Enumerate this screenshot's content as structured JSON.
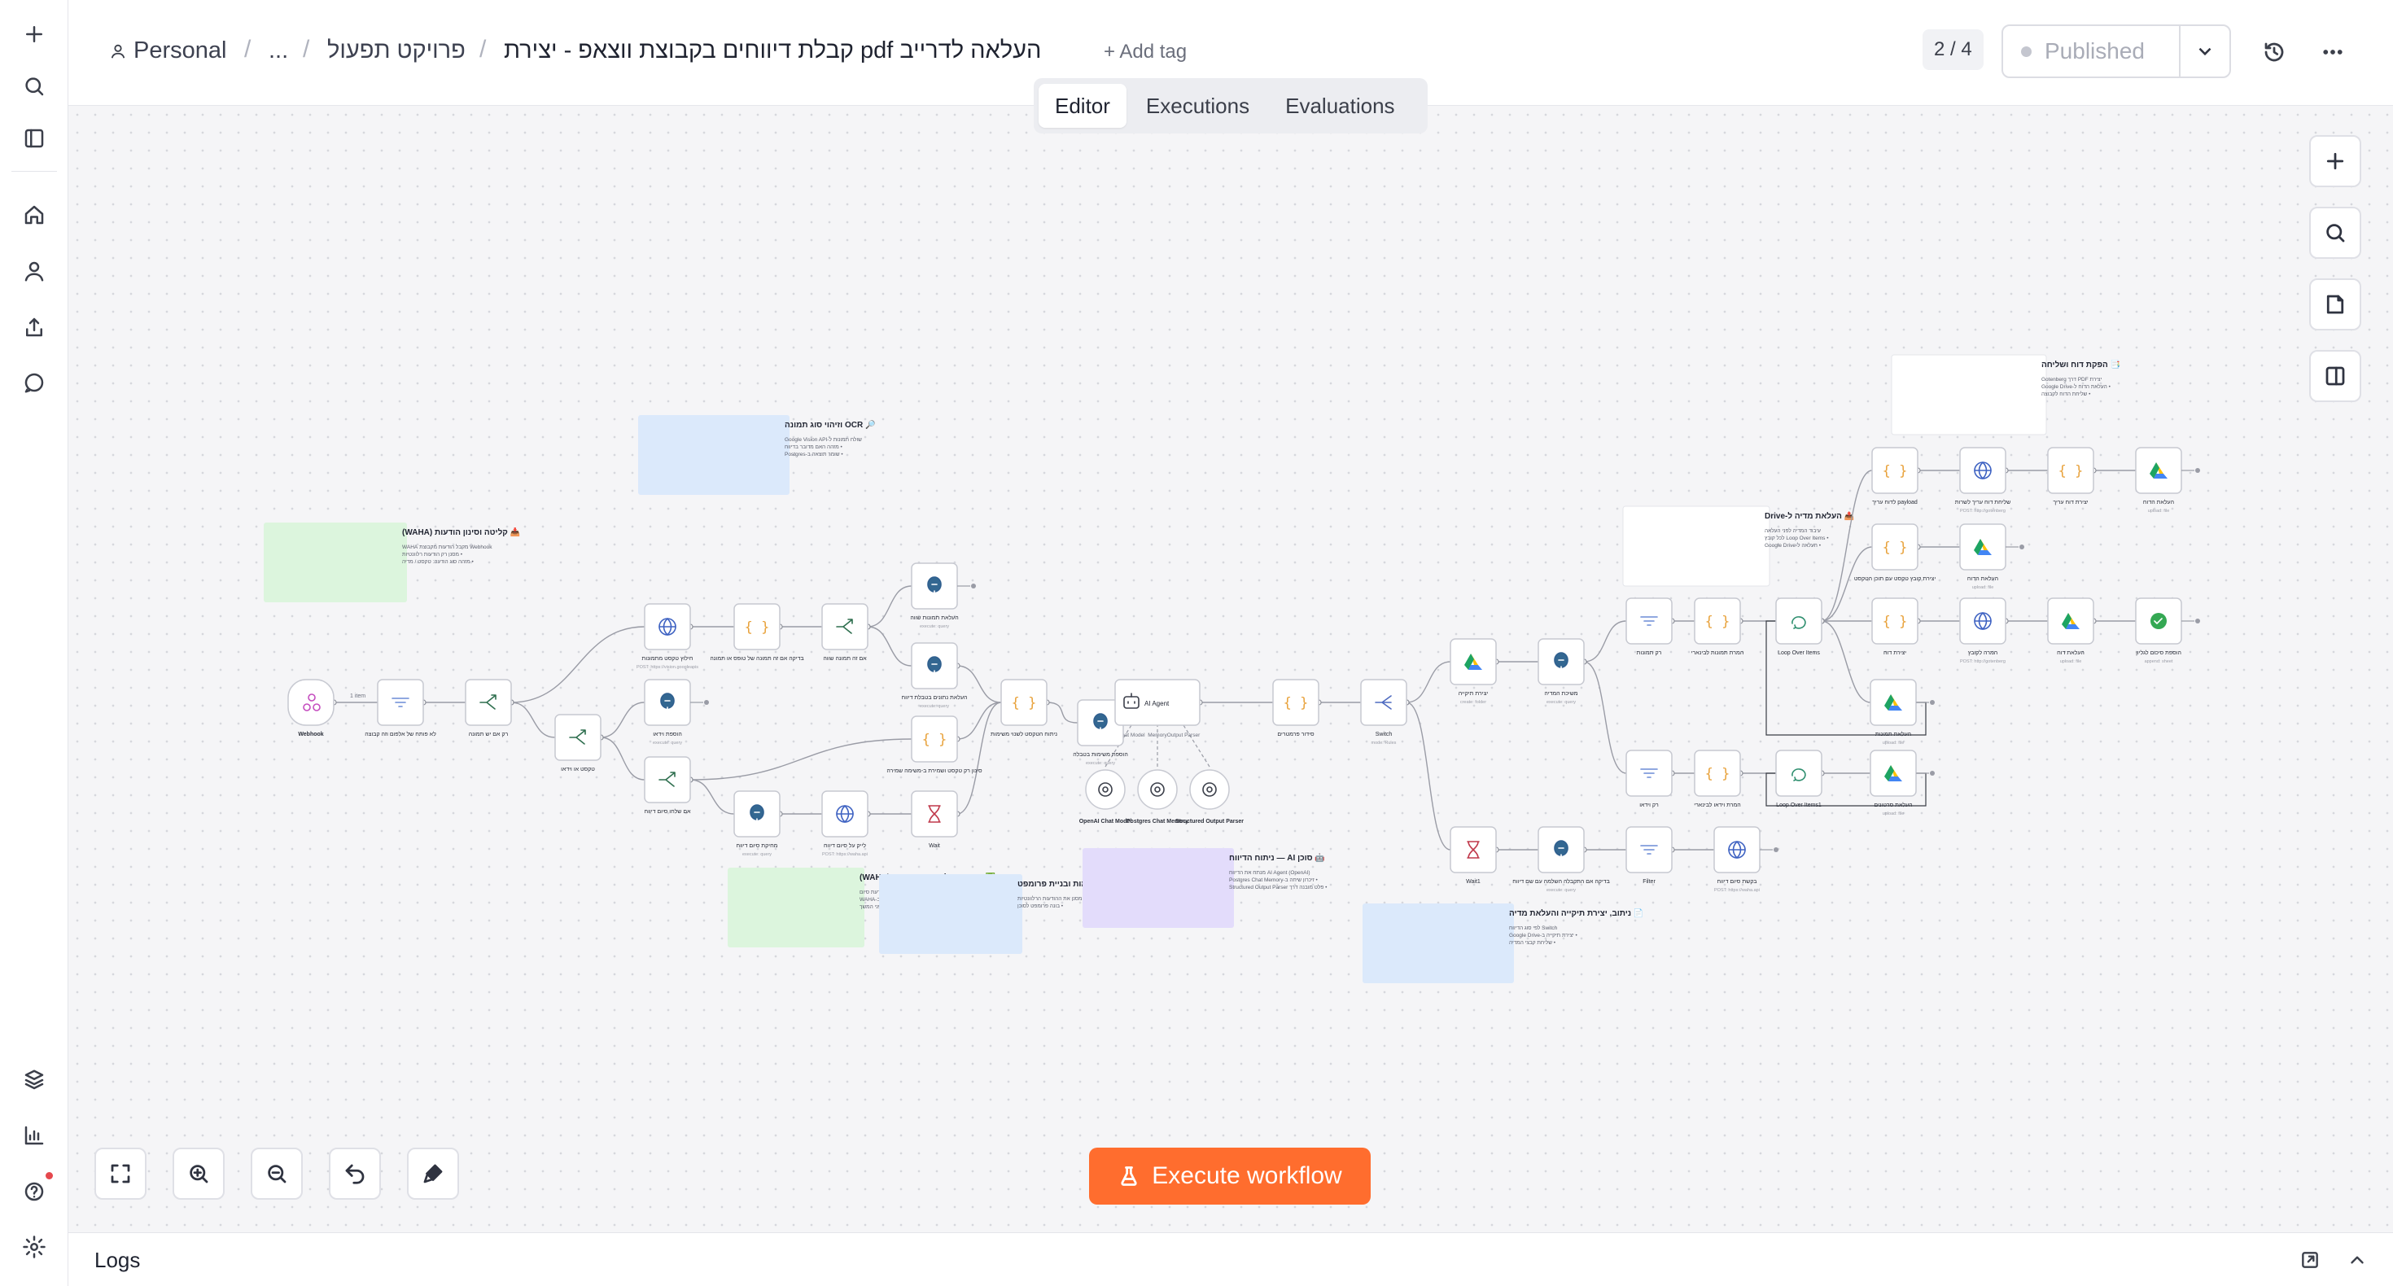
{
  "header": {
    "owner": "Personal",
    "ellipsis": "...",
    "project": "פרויקט תפעול",
    "workflow_title": "העלאה לדרייב pdf קבלת דיווחים בקבוצת ווצאפ - יצירת",
    "add_tag": "+ Add tag",
    "counter": "2 / 4",
    "publish_label": "Published"
  },
  "tabs": [
    {
      "label": "Editor",
      "active": true
    },
    {
      "label": "Executions",
      "active": false
    },
    {
      "label": "Evaluations",
      "active": false
    }
  ],
  "execute_label": "Execute workflow",
  "logs_label": "Logs",
  "colors": {
    "accent": "#ff6d2e",
    "canvas_bg": "#f5f5f7",
    "note_green": "#dcf5dd",
    "note_blue": "#dbe9fb",
    "note_purple": "#e3dcfb",
    "note_neutral": "#ffffff",
    "edge": "#9a9ca6",
    "edge_loop": "#3a3d46"
  },
  "workflow": {
    "notes": [
      {
        "id": "n1",
        "color": "green",
        "title": "📥 קליטה וסינון הודעות (WAHA)",
        "lines": [
          "Webhook מקבל הודעות מקבוצת WAHA",
          "• מסנן רק הודעות רלוונטיות",
          "• מזהה סוג הודעה: טקסט / מדיה"
        ]
      },
      {
        "id": "n2",
        "color": "blue",
        "title": "🔎 OCR וזיהוי סוג תמונה",
        "lines": [
          "שולח תמונות ל-Google Vision API",
          "• מזהה האם מדובר בדיווח",
          "• שומר תוצאה ב-Postgres"
        ]
      },
      {
        "id": "n3",
        "color": "green",
        "title": "✅ אישור קבלת \"סיום דיווח\" (WAHA)",
        "lines": [
          "בודק אם התקבלה הודעת סיום",
          "• שולח אישור ב-WAHA",
          "• Wait — ממתין לפני המשך"
        ]
      },
      {
        "id": "n4",
        "color": "blue",
        "title": "⚙ סינון משימות ובניית פרומפט",
        "lines": [
          "מסנן את ההודעות הרלוונטיות",
          "• בונה פרומפט לסוכן"
        ]
      },
      {
        "id": "n5",
        "color": "purple",
        "title": "🤖 סוכן AI — ניתוח הדיווח",
        "lines": [
          "AI Agent (OpenAI) מנתח את הדיווח",
          "• זיכרון שיחה ב-Postgres Chat Memory",
          "• פלט מובנה דרך Structured Output Parser"
        ]
      },
      {
        "id": "n6",
        "color": "blue",
        "title": "📄 ניתוב, יצירת תיקייה והעלאת מדיה",
        "lines": [
          "Switch לפי סוג הדיווח",
          "• יצירת תיקייה ב-Google Drive",
          "• שליחת קבצי המדיה"
        ]
      },
      {
        "id": "n7",
        "color": "neutral",
        "title": "📤 העלאת מדיה ל-Drive",
        "lines": [
          "עיבוד המדיה לפני העלאה",
          "• Loop Over Items לכל קובץ",
          "• העלאה ל-Google Drive"
        ]
      },
      {
        "id": "n8",
        "color": "neutral",
        "title": "📑 הפקת דוח ושליחה",
        "lines": [
          "יצירת PDF דרך Gotenberg",
          "• העלאת הדוח ל-Google Drive",
          "• שליחת הדוח לקבוצה"
        ]
      }
    ],
    "nodes": [
      {
        "id": "webhook",
        "label": "Webhook",
        "sub": "",
        "icon": "webhook-icon",
        "kind": "trigger"
      },
      {
        "id": "filter1",
        "label": "לא פותח של אלפום וזה קבוצה",
        "sub": "",
        "icon": "filter-icon",
        "kind": "filter"
      },
      {
        "id": "if1",
        "label": "רק אם יש תמונה",
        "sub": "",
        "icon": "branch-icon",
        "kind": "if"
      },
      {
        "id": "if2",
        "label": "טקסט או וידאו",
        "sub": "",
        "icon": "branch-icon",
        "kind": "if"
      },
      {
        "id": "http1",
        "label": "חילוץ טקסט מתמונות",
        "sub": "POST: https://vision.googleapis",
        "icon": "globe-icon",
        "kind": "http"
      },
      {
        "id": "code1",
        "label": "בדיקה אם זה תמונה של טופס או תמונה",
        "sub": "",
        "icon": "code-icon",
        "kind": "code"
      },
      {
        "id": "if3",
        "label": "אם זה תמונה שווה",
        "sub": "",
        "icon": "branch-icon",
        "kind": "if"
      },
      {
        "id": "pg1",
        "label": "העלאת תמונות שווה",
        "sub": "execute: query",
        "icon": "postgres-icon",
        "kind": "pg"
      },
      {
        "id": "pg2",
        "label": "העלאת נתונים בטבלת דיווח",
        "sub": "execute: query",
        "icon": "postgres-icon",
        "kind": "pg"
      },
      {
        "id": "pg3",
        "label": "הוספת וידאו",
        "sub": "execute: query",
        "icon": "postgres-icon",
        "kind": "pg"
      },
      {
        "id": "if4",
        "label": "אם שלחו סיום דיווח",
        "sub": "",
        "icon": "branch-icon",
        "kind": "if"
      },
      {
        "id": "code2",
        "label": "סינון רק טקסט ושמירת ב-משימה שמירה",
        "sub": "",
        "icon": "code-icon",
        "kind": "code"
      },
      {
        "id": "pg4",
        "label": "מחיקת סיום דיווח",
        "sub": "execute: query",
        "icon": "postgres-icon",
        "kind": "pg"
      },
      {
        "id": "http2",
        "label": "לייק על סיום דיווח",
        "sub": "POST: https://waha.api",
        "icon": "globe-icon",
        "kind": "http"
      },
      {
        "id": "wait1",
        "label": "Wait",
        "sub": "",
        "icon": "hourglass-icon",
        "kind": "wait"
      },
      {
        "id": "code3",
        "label": "ניתוח הטקסט לשנוי משימות",
        "sub": "",
        "icon": "code-icon",
        "kind": "code"
      },
      {
        "id": "pg5",
        "label": "הוספת משימות בטבלה",
        "sub": "execute: query",
        "icon": "postgres-icon",
        "kind": "pg"
      },
      {
        "id": "agent",
        "label": "AI Agent",
        "sub": "",
        "icon": "robot-icon",
        "kind": "agent"
      },
      {
        "id": "openai",
        "label": "OpenAI Chat Model",
        "sub": "",
        "icon": "openai-icon",
        "kind": "sub"
      },
      {
        "id": "memory",
        "label": "Postgres Chat Memory",
        "sub": "",
        "icon": "postgres-icon",
        "kind": "sub"
      },
      {
        "id": "parser",
        "label": "Structured Output Parser",
        "sub": "",
        "icon": "braces-icon",
        "kind": "sub"
      },
      {
        "id": "code4",
        "label": "סידור פרמטרים",
        "sub": "",
        "icon": "code-icon",
        "kind": "code"
      },
      {
        "id": "switch",
        "label": "Switch",
        "sub": "mode: Rules",
        "icon": "switch-icon",
        "kind": "switch"
      },
      {
        "id": "gd1",
        "label": "יצירת תיקייה",
        "sub": "create: folder",
        "icon": "gdrive-icon",
        "kind": "gdrive"
      },
      {
        "id": "pg6",
        "label": "משיכת המדיה",
        "sub": "execute: query",
        "icon": "postgres-icon",
        "kind": "pg"
      },
      {
        "id": "filter2",
        "label": "רק תמונות",
        "sub": "",
        "icon": "filter-icon",
        "kind": "filter"
      },
      {
        "id": "code5",
        "label": "המרת תמונות לבינארי",
        "sub": "",
        "icon": "code-icon",
        "kind": "code"
      },
      {
        "id": "loop1",
        "label": "Loop Over Items",
        "sub": "",
        "icon": "loop-icon",
        "kind": "loop"
      },
      {
        "id": "gd2",
        "label": "העלאת תמונות",
        "sub": "upload: file",
        "icon": "gdrive-icon",
        "kind": "gdrive"
      },
      {
        "id": "filter3",
        "label": "רק וידאו",
        "sub": "",
        "icon": "filter-icon",
        "kind": "filter"
      },
      {
        "id": "code6",
        "label": "המרת וידאו לבינארי",
        "sub": "",
        "icon": "code-icon",
        "kind": "code"
      },
      {
        "id": "loop2",
        "label": "Loop Over Items1",
        "sub": "",
        "icon": "loop-icon",
        "kind": "loop"
      },
      {
        "id": "gd3",
        "label": "העלאת סרטונים",
        "sub": "upload: file",
        "icon": "gdrive-icon",
        "kind": "gdrive"
      },
      {
        "id": "code7",
        "label": "payload לדוח עריך",
        "sub": "",
        "icon": "code-icon",
        "kind": "code"
      },
      {
        "id": "http3",
        "label": "שליחת דוח עריך לשרות",
        "sub": "POST: http://gotenberg",
        "icon": "globe-icon",
        "kind": "http"
      },
      {
        "id": "code8",
        "label": "יצירת דוח עריך",
        "sub": "",
        "icon": "code-icon",
        "kind": "code"
      },
      {
        "id": "gd4",
        "label": "העלאת הדוח",
        "sub": "upload: file",
        "icon": "gdrive-icon",
        "kind": "gdrive"
      },
      {
        "id": "code9",
        "label": "יצירת קובץ טקסט עם תוכן הטקסט",
        "sub": "",
        "icon": "code-icon",
        "kind": "code"
      },
      {
        "id": "gd5",
        "label": "העלאת הדוח",
        "sub": "upload: file",
        "icon": "gdrive-icon",
        "kind": "gdrive"
      },
      {
        "id": "code10",
        "label": "יצירת דוח",
        "sub": "",
        "icon": "code-icon",
        "kind": "code"
      },
      {
        "id": "http4",
        "label": "המרה לקובץ",
        "sub": "POST: http://gotenberg",
        "icon": "globe-icon",
        "kind": "http"
      },
      {
        "id": "gd6",
        "label": "העלאת דוח",
        "sub": "upload: file",
        "icon": "gdrive-icon",
        "kind": "gdrive"
      },
      {
        "id": "sheets1",
        "label": "הוספת סיכום לגליון",
        "sub": "append: sheet",
        "icon": "sheets-icon",
        "kind": "sheets"
      },
      {
        "id": "wait2",
        "label": "Wait1",
        "sub": "",
        "icon": "hourglass-icon",
        "kind": "wait"
      },
      {
        "id": "pg7",
        "label": "בדיקה אם התקבלה השלמה עם שם דיווח",
        "sub": "execute: query",
        "icon": "postgres-icon",
        "kind": "pg"
      },
      {
        "id": "filter4",
        "label": "Filter",
        "sub": "",
        "icon": "filter-icon",
        "kind": "filter"
      },
      {
        "id": "http5",
        "label": "בקשת סיום דיווח",
        "sub": "POST: https://waha.api",
        "icon": "globe-icon",
        "kind": "http"
      }
    ],
    "sub_links": [
      "Chat Model",
      "Memory",
      "Output Parser"
    ],
    "edge_badge": "1 item"
  }
}
